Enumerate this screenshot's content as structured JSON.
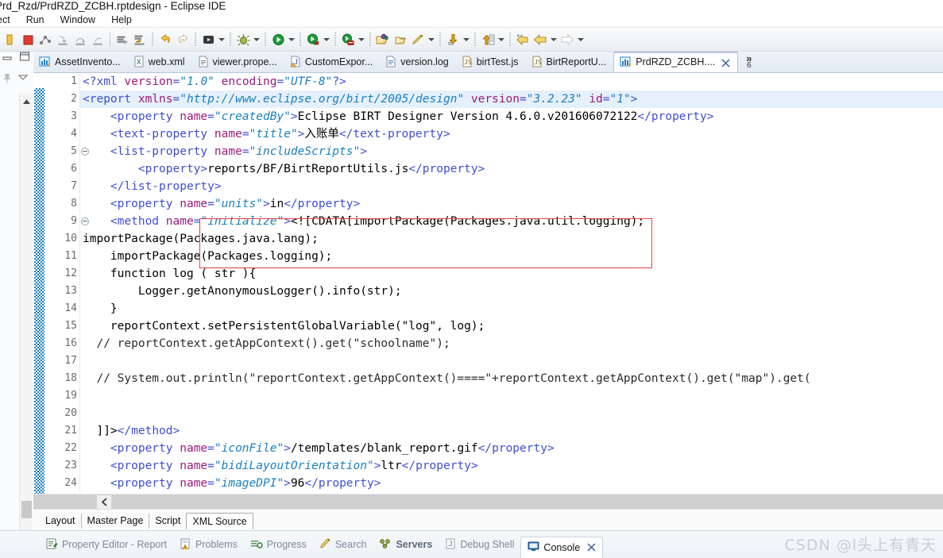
{
  "window": {
    "title": "Prd_Rzd/PrdRZD_ZCBH.rptdesign - Eclipse IDE"
  },
  "menubar": {
    "items": [
      {
        "label": "ect",
        "clipped": true
      },
      {
        "label": "Run"
      },
      {
        "label": "Window"
      },
      {
        "label": "Help"
      }
    ]
  },
  "toolbar": {
    "icons": [
      "save-icon",
      "stop-icon",
      "profile-icon",
      "step-into-icon",
      "step-over-icon",
      "step-return-icon",
      "run-last-tool-icon",
      "debug-last-tool-icon",
      "undo-icon",
      "redo-icon",
      "run-as-icon",
      "debug-icon",
      "run-icon",
      "coverage-icon",
      "new-wizard-icon",
      "open-type-icon",
      "edit-icon",
      "export-icon",
      "import-icon",
      "back-icon",
      "previous-edit-icon",
      "forward-icon"
    ]
  },
  "editor_tabs": {
    "tabs": [
      {
        "label": "AssetInvento...",
        "icon": "birt-report-icon",
        "active": false
      },
      {
        "label": "web.xml",
        "icon": "xml-file-icon",
        "active": false
      },
      {
        "label": "viewer.prope...",
        "icon": "properties-file-icon",
        "active": false
      },
      {
        "label": "CustomExpor...",
        "icon": "java-warning-file-icon",
        "active": false
      },
      {
        "label": "version.log",
        "icon": "log-file-icon",
        "active": false
      },
      {
        "label": "birtTest.js",
        "icon": "js-file-icon",
        "active": false
      },
      {
        "label": "BirtReportU...",
        "icon": "js-file-icon",
        "active": false
      },
      {
        "label": "PrdRZD_ZCBH....",
        "icon": "birt-report-icon",
        "active": true
      }
    ],
    "overflow_count": "6",
    "overflow_chevron": "»"
  },
  "code": {
    "lines": [
      {
        "num": "1",
        "fold": false,
        "current": false,
        "tokens": [
          {
            "t": "punct",
            "v": "<?"
          },
          {
            "t": "tagname",
            "v": "xml"
          },
          {
            "t": "text",
            "v": " "
          },
          {
            "t": "attr",
            "v": "version"
          },
          {
            "t": "punct",
            "v": "="
          },
          {
            "t": "avalue",
            "v": "\"1.0\""
          },
          {
            "t": "text",
            "v": " "
          },
          {
            "t": "attr",
            "v": "encoding"
          },
          {
            "t": "punct",
            "v": "="
          },
          {
            "t": "avalue",
            "v": "\"UTF-8\""
          },
          {
            "t": "punct",
            "v": "?>"
          }
        ]
      },
      {
        "num": "2",
        "fold": true,
        "current": true,
        "tokens": [
          {
            "t": "punct",
            "v": "<"
          },
          {
            "t": "tagname",
            "v": "report"
          },
          {
            "t": "text",
            "v": " "
          },
          {
            "t": "attr",
            "v": "xmlns"
          },
          {
            "t": "punct",
            "v": "="
          },
          {
            "t": "avalue",
            "v": "\"http://www.eclipse.org/birt/2005/design\""
          },
          {
            "t": "text",
            "v": " "
          },
          {
            "t": "attr",
            "v": "version"
          },
          {
            "t": "punct",
            "v": "="
          },
          {
            "t": "avalue",
            "v": "\"3.2.23\""
          },
          {
            "t": "text",
            "v": " "
          },
          {
            "t": "attr",
            "v": "id"
          },
          {
            "t": "punct",
            "v": "="
          },
          {
            "t": "avalue",
            "v": "\"1\""
          },
          {
            "t": "punct",
            "v": ">"
          }
        ]
      },
      {
        "num": "3",
        "fold": false,
        "current": false,
        "tokens": [
          {
            "t": "text",
            "v": "    "
          },
          {
            "t": "punct",
            "v": "<"
          },
          {
            "t": "tagname",
            "v": "property"
          },
          {
            "t": "text",
            "v": " "
          },
          {
            "t": "attr",
            "v": "name"
          },
          {
            "t": "punct",
            "v": "="
          },
          {
            "t": "avalue",
            "v": "\"createdBy\""
          },
          {
            "t": "punct",
            "v": ">"
          },
          {
            "t": "text",
            "v": "Eclipse BIRT Designer Version 4.6.0.v201606072122"
          },
          {
            "t": "punct",
            "v": "</"
          },
          {
            "t": "tagname",
            "v": "property"
          },
          {
            "t": "punct",
            "v": ">"
          }
        ]
      },
      {
        "num": "4",
        "fold": false,
        "current": false,
        "tokens": [
          {
            "t": "text",
            "v": "    "
          },
          {
            "t": "punct",
            "v": "<"
          },
          {
            "t": "tagname",
            "v": "text-property"
          },
          {
            "t": "text",
            "v": " "
          },
          {
            "t": "attr",
            "v": "name"
          },
          {
            "t": "punct",
            "v": "="
          },
          {
            "t": "avalue",
            "v": "\"title\""
          },
          {
            "t": "punct",
            "v": ">"
          },
          {
            "t": "text",
            "v": "入账单"
          },
          {
            "t": "punct",
            "v": "</"
          },
          {
            "t": "tagname",
            "v": "text-property"
          },
          {
            "t": "punct",
            "v": ">"
          }
        ]
      },
      {
        "num": "5",
        "fold": true,
        "current": false,
        "tokens": [
          {
            "t": "text",
            "v": "    "
          },
          {
            "t": "punct",
            "v": "<"
          },
          {
            "t": "tagname",
            "v": "list-property"
          },
          {
            "t": "text",
            "v": " "
          },
          {
            "t": "attr",
            "v": "name"
          },
          {
            "t": "punct",
            "v": "="
          },
          {
            "t": "avalue",
            "v": "\"includeScripts\""
          },
          {
            "t": "punct",
            "v": ">"
          }
        ]
      },
      {
        "num": "6",
        "fold": false,
        "current": false,
        "tokens": [
          {
            "t": "text",
            "v": "        "
          },
          {
            "t": "punct",
            "v": "<"
          },
          {
            "t": "tagname",
            "v": "property"
          },
          {
            "t": "punct",
            "v": ">"
          },
          {
            "t": "text",
            "v": "reports/BF/BirtReportUtils.js"
          },
          {
            "t": "punct",
            "v": "</"
          },
          {
            "t": "tagname",
            "v": "property"
          },
          {
            "t": "punct",
            "v": ">"
          }
        ]
      },
      {
        "num": "7",
        "fold": false,
        "current": false,
        "tokens": [
          {
            "t": "text",
            "v": "    "
          },
          {
            "t": "punct",
            "v": "</"
          },
          {
            "t": "tagname",
            "v": "list-property"
          },
          {
            "t": "punct",
            "v": ">"
          }
        ]
      },
      {
        "num": "8",
        "fold": false,
        "current": false,
        "tokens": [
          {
            "t": "text",
            "v": "    "
          },
          {
            "t": "punct",
            "v": "<"
          },
          {
            "t": "tagname",
            "v": "property"
          },
          {
            "t": "text",
            "v": " "
          },
          {
            "t": "attr",
            "v": "name"
          },
          {
            "t": "punct",
            "v": "="
          },
          {
            "t": "avalue",
            "v": "\"units\""
          },
          {
            "t": "punct",
            "v": ">"
          },
          {
            "t": "text",
            "v": "in"
          },
          {
            "t": "punct",
            "v": "</"
          },
          {
            "t": "tagname",
            "v": "property"
          },
          {
            "t": "punct",
            "v": ">"
          }
        ]
      },
      {
        "num": "9",
        "fold": true,
        "current": false,
        "tokens": [
          {
            "t": "text",
            "v": "    "
          },
          {
            "t": "punct",
            "v": "<"
          },
          {
            "t": "tagname",
            "v": "method"
          },
          {
            "t": "text",
            "v": " "
          },
          {
            "t": "attr",
            "v": "name"
          },
          {
            "t": "punct",
            "v": "="
          },
          {
            "t": "avalue",
            "v": "\"initialize\""
          },
          {
            "t": "punct",
            "v": ">"
          },
          {
            "t": "text",
            "v": "<![CDATA[importPackage(Packages.java.util.logging);"
          }
        ]
      },
      {
        "num": "10",
        "fold": false,
        "current": false,
        "tokens": [
          {
            "t": "text",
            "v": "importPackage(Packages.java.lang);"
          }
        ]
      },
      {
        "num": "11",
        "fold": false,
        "current": false,
        "tokens": [
          {
            "t": "text",
            "v": "    importPackage(Packages.logging);"
          }
        ]
      },
      {
        "num": "12",
        "fold": false,
        "current": false,
        "tokens": [
          {
            "t": "text",
            "v": "    function log ( str ){"
          }
        ]
      },
      {
        "num": "13",
        "fold": false,
        "current": false,
        "tokens": [
          {
            "t": "text",
            "v": "        Logger.getAnonymousLogger().info(str);"
          }
        ]
      },
      {
        "num": "14",
        "fold": false,
        "current": false,
        "tokens": [
          {
            "t": "text",
            "v": "    }"
          }
        ]
      },
      {
        "num": "15",
        "fold": false,
        "current": false,
        "tokens": [
          {
            "t": "text",
            "v": "    reportContext.setPersistentGlobalVariable(\"log\", log);"
          }
        ]
      },
      {
        "num": "16",
        "fold": false,
        "current": false,
        "tokens": [
          {
            "t": "comment",
            "v": "  // reportContext.getAppContext().get(\"schoolname\");"
          }
        ]
      },
      {
        "num": "17",
        "fold": false,
        "current": false,
        "tokens": [
          {
            "t": "text",
            "v": ""
          }
        ]
      },
      {
        "num": "18",
        "fold": false,
        "current": false,
        "tokens": [
          {
            "t": "comment",
            "v": "  // System.out.println(\"reportContext.getAppContext()====\"+reportContext.getAppContext().get(\"map\").get("
          }
        ]
      },
      {
        "num": "19",
        "fold": false,
        "current": false,
        "tokens": [
          {
            "t": "text",
            "v": ""
          }
        ]
      },
      {
        "num": "20",
        "fold": false,
        "current": false,
        "tokens": [
          {
            "t": "text",
            "v": ""
          }
        ]
      },
      {
        "num": "21",
        "fold": false,
        "current": false,
        "tokens": [
          {
            "t": "text",
            "v": "  ]]>"
          },
          {
            "t": "punct",
            "v": "</"
          },
          {
            "t": "tagname",
            "v": "method"
          },
          {
            "t": "punct",
            "v": ">"
          }
        ]
      },
      {
        "num": "22",
        "fold": false,
        "current": false,
        "tokens": [
          {
            "t": "text",
            "v": "    "
          },
          {
            "t": "punct",
            "v": "<"
          },
          {
            "t": "tagname",
            "v": "property"
          },
          {
            "t": "text",
            "v": " "
          },
          {
            "t": "attr",
            "v": "name"
          },
          {
            "t": "punct",
            "v": "="
          },
          {
            "t": "avalue",
            "v": "\"iconFile\""
          },
          {
            "t": "punct",
            "v": ">"
          },
          {
            "t": "text",
            "v": "/templates/blank_report.gif"
          },
          {
            "t": "punct",
            "v": "</"
          },
          {
            "t": "tagname",
            "v": "property"
          },
          {
            "t": "punct",
            "v": ">"
          }
        ]
      },
      {
        "num": "23",
        "fold": false,
        "current": false,
        "tokens": [
          {
            "t": "text",
            "v": "    "
          },
          {
            "t": "punct",
            "v": "<"
          },
          {
            "t": "tagname",
            "v": "property"
          },
          {
            "t": "text",
            "v": " "
          },
          {
            "t": "attr",
            "v": "name"
          },
          {
            "t": "punct",
            "v": "="
          },
          {
            "t": "avalue",
            "v": "\"bidiLayoutOrientation\""
          },
          {
            "t": "punct",
            "v": ">"
          },
          {
            "t": "text",
            "v": "ltr"
          },
          {
            "t": "punct",
            "v": "</"
          },
          {
            "t": "tagname",
            "v": "property"
          },
          {
            "t": "punct",
            "v": ">"
          }
        ]
      },
      {
        "num": "24",
        "fold": false,
        "current": false,
        "tokens": [
          {
            "t": "text",
            "v": "    "
          },
          {
            "t": "punct",
            "v": "<"
          },
          {
            "t": "tagname",
            "v": "property"
          },
          {
            "t": "text",
            "v": " "
          },
          {
            "t": "attr",
            "v": "name"
          },
          {
            "t": "punct",
            "v": "="
          },
          {
            "t": "avalue",
            "v": "\"imageDPI\""
          },
          {
            "t": "punct",
            "v": ">"
          },
          {
            "t": "text",
            "v": "96"
          },
          {
            "t": "punct",
            "v": "</"
          },
          {
            "t": "tagname",
            "v": "property"
          },
          {
            "t": "punct",
            "v": ">"
          }
        ]
      }
    ],
    "highlight_box_color": "#e8413a"
  },
  "page_tabs": {
    "tabs": [
      {
        "label": "Layout",
        "active": false
      },
      {
        "label": "Master Page",
        "active": false
      },
      {
        "label": "Script",
        "active": false
      },
      {
        "label": "XML Source",
        "active": true
      }
    ]
  },
  "bottom_views": {
    "tabs": [
      {
        "label": "Property Editor - Report",
        "icon": "property-editor-icon",
        "active": false,
        "bold": false
      },
      {
        "label": "Problems",
        "icon": "problems-icon",
        "active": false,
        "bold": false
      },
      {
        "label": "Progress",
        "icon": "progress-icon",
        "active": false,
        "bold": false
      },
      {
        "label": "Search",
        "icon": "search-icon",
        "active": false,
        "bold": false
      },
      {
        "label": "Servers",
        "icon": "servers-icon",
        "active": false,
        "bold": true
      },
      {
        "label": "Debug Shell",
        "icon": "debug-shell-icon",
        "active": false,
        "bold": false
      },
      {
        "label": "Console",
        "icon": "console-icon",
        "active": true,
        "bold": false
      }
    ]
  },
  "watermark": {
    "text": "CSDN @l头上有青天"
  }
}
